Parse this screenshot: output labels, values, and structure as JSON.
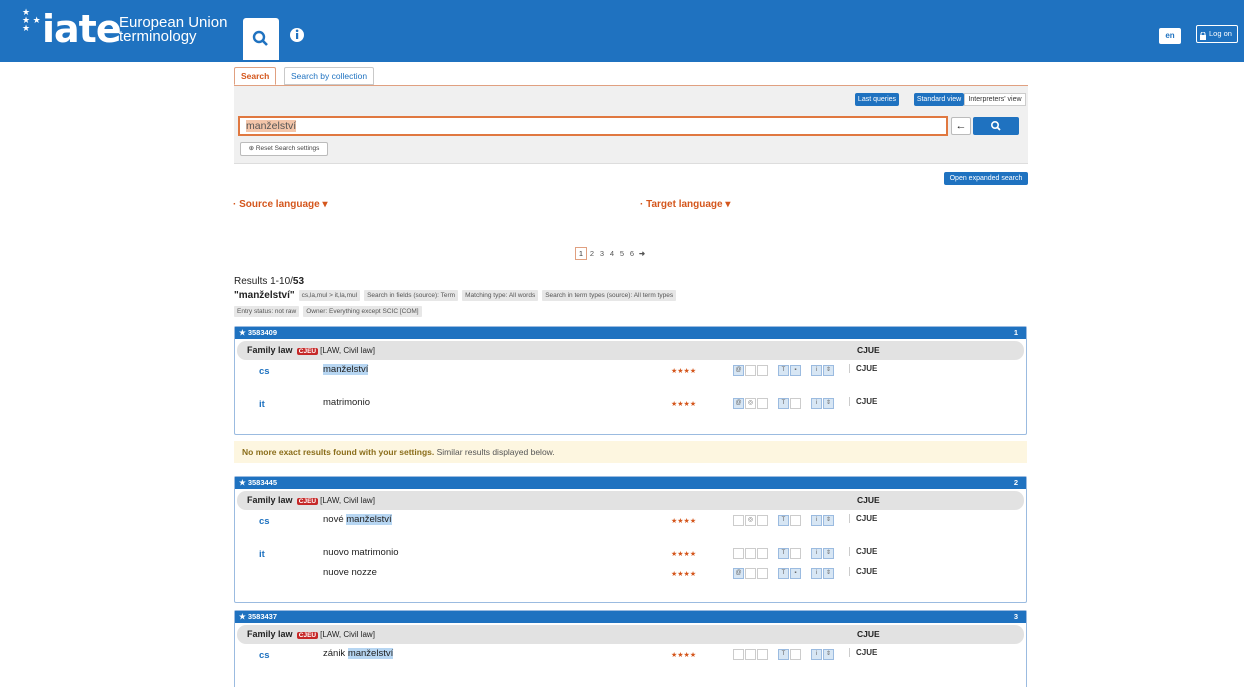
{
  "header": {
    "logo_word": "iate",
    "logo_sub_line1": "European Union",
    "logo_sub_line2": "terminology",
    "lang": "en",
    "logon": "Log on"
  },
  "tabs": {
    "search": "Search",
    "collection": "Search by collection"
  },
  "panel": {
    "last_queries": "Last queries",
    "standard_view": "Standard view",
    "interpreters_view": "Interpreters' view",
    "query": "manželství",
    "reset": "⊕ Reset Search settings",
    "expanded": "Open expanded search"
  },
  "source_language": "· Source language ▾",
  "target_language": "· Target language ▾",
  "pagination": [
    "1",
    "2",
    "3",
    "4",
    "5",
    "6"
  ],
  "results": {
    "label": "Results 1-10/",
    "total": "53",
    "query_quoted": "\"manželství\"",
    "chips1": [
      "cs,la,mul > it,la,mul",
      "Search in fields (source): Term",
      "Matching type: All words",
      "Search in term types (source): All term types"
    ],
    "chips2": [
      "Entry status: not raw",
      "Owner: Everything except SCIC [COM]"
    ]
  },
  "no_more": {
    "bold": "No more exact results found with your settings.",
    "rest": " Similar results displayed below."
  },
  "entries": [
    {
      "id": "3583409",
      "index": "1",
      "domain": "Family law",
      "badge": "CJEU",
      "domain_rest": "[LAW, Civil law]",
      "source": "CJUE",
      "terms": [
        {
          "lang": "cs",
          "pre": "",
          "hl": "manželství",
          "post": "",
          "stars": "★★★★",
          "src": "CJUE"
        },
        {
          "lang": "it",
          "pre": "matrimonio",
          "hl": "",
          "post": "",
          "stars": "★★★★",
          "src": "CJUE"
        }
      ]
    },
    {
      "id": "3583445",
      "index": "2",
      "domain": "Family law",
      "badge": "CJEU",
      "domain_rest": "[LAW, Civil law]",
      "source": "CJUE",
      "terms": [
        {
          "lang": "cs",
          "pre": "nové ",
          "hl": "manželství",
          "post": "",
          "stars": "★★★★",
          "src": "CJUE"
        },
        {
          "lang": "it",
          "pre": "nuovo matrimonio",
          "hl": "",
          "post": "",
          "stars": "★★★★",
          "src": "CJUE"
        },
        {
          "lang": "",
          "pre": "nuove nozze",
          "hl": "",
          "post": "",
          "stars": "★★★★",
          "src": "CJUE"
        }
      ]
    },
    {
      "id": "3583437",
      "index": "3",
      "domain": "Family law",
      "badge": "CJEU",
      "domain_rest": "[LAW, Civil law]",
      "source": "CJUE",
      "terms": [
        {
          "lang": "cs",
          "pre": "zánik ",
          "hl": "manželství",
          "post": "",
          "stars": "★★★★",
          "src": "CJUE"
        }
      ]
    }
  ]
}
